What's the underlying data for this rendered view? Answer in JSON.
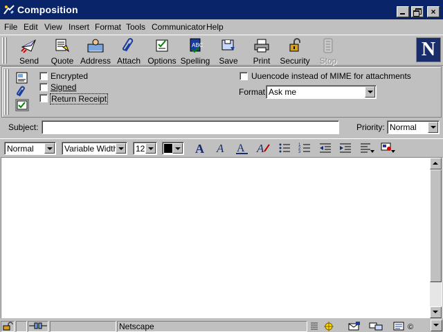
{
  "window": {
    "title": "Composition"
  },
  "menu": [
    {
      "label": "File"
    },
    {
      "label": "Edit"
    },
    {
      "label": "View"
    },
    {
      "label": "Insert"
    },
    {
      "label": "Format"
    },
    {
      "label": "Tools"
    },
    {
      "label": "Communicator"
    },
    {
      "label": "Help"
    }
  ],
  "toolbar": {
    "send": "Send",
    "quote": "Quote",
    "address": "Address",
    "attach": "Attach",
    "options": "Options",
    "spelling": "Spelling",
    "save": "Save",
    "print": "Print",
    "security": "Security",
    "stop": "Stop",
    "brand_letter": "N"
  },
  "options": {
    "encrypted": "Encrypted",
    "signed": "Signed",
    "return_receipt": "Return Receipt",
    "uuencode": "Uuencode instead of MIME for attachments",
    "format_label": "Format",
    "format_value": "Ask me"
  },
  "subject": {
    "label": "Subject:",
    "value": ""
  },
  "priority": {
    "label": "Priority:",
    "value": "Normal"
  },
  "format_bar": {
    "paragraph_style": "Normal",
    "font": "Variable Width",
    "size": "12",
    "color": "#000000"
  },
  "status": {
    "text": "Netscape"
  },
  "colors": {
    "titlebar": "#0a246a",
    "face": "#c0c0c0"
  }
}
